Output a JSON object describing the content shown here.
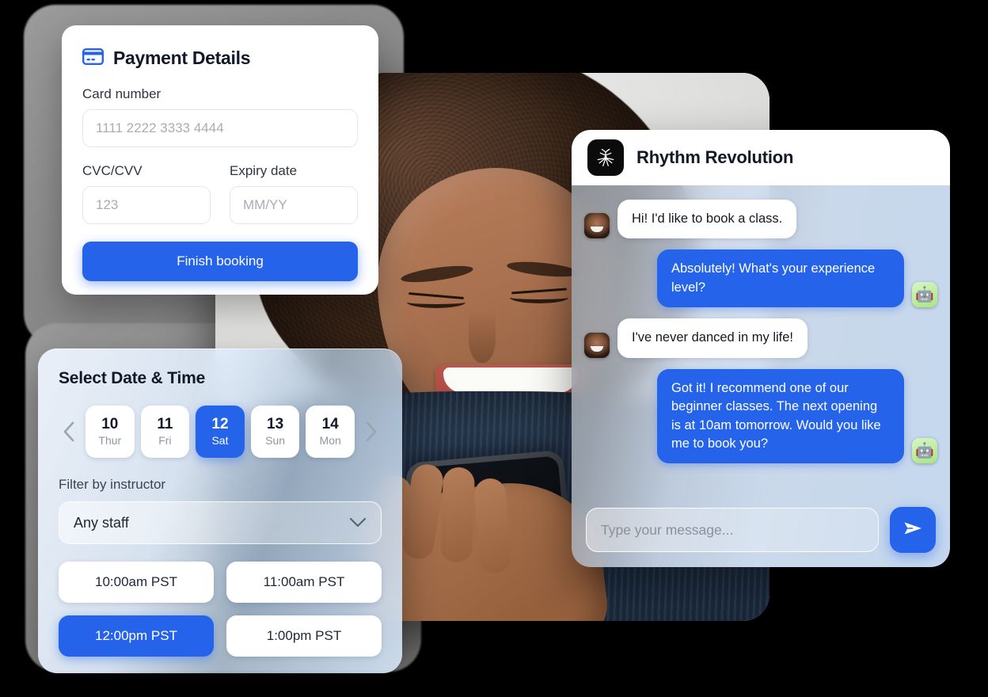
{
  "payment": {
    "icon": "credit-card-icon",
    "title": "Payment Details",
    "card_number_label": "Card number",
    "card_number_placeholder": "1111 2222 3333 4444",
    "cvc_label": "CVC/CVV",
    "cvc_placeholder": "123",
    "expiry_label": "Expiry date",
    "expiry_placeholder": "MM/YY",
    "submit_label": "Finish booking"
  },
  "datetime": {
    "title": "Select Date & Time",
    "prev_icon": "chevron-left-icon",
    "next_icon": "chevron-right-icon",
    "days": [
      {
        "num": "10",
        "dow": "Thur",
        "selected": false
      },
      {
        "num": "11",
        "dow": "Fri",
        "selected": false
      },
      {
        "num": "12",
        "dow": "Sat",
        "selected": true
      },
      {
        "num": "13",
        "dow": "Sun",
        "selected": false
      },
      {
        "num": "14",
        "dow": "Mon",
        "selected": false
      }
    ],
    "filter_label": "Filter by instructor",
    "filter_value": "Any staff",
    "filter_chevron_icon": "chevron-down-icon",
    "slots": [
      {
        "label": "10:00am PST",
        "selected": false
      },
      {
        "label": "11:00am PST",
        "selected": false
      },
      {
        "label": "12:00pm PST",
        "selected": true
      },
      {
        "label": "1:00pm PST",
        "selected": false
      }
    ]
  },
  "chat": {
    "logo_icon": "dancer-logo-icon",
    "title": "Rhythm Revolution",
    "messages": [
      {
        "from": "user",
        "text": "Hi! I'd like to book a class.",
        "avatar": "user-avatar"
      },
      {
        "from": "bot",
        "text": "Absolutely! What's your experience level?",
        "avatar": "robot-avatar"
      },
      {
        "from": "user",
        "text": "I've never danced in my life!",
        "avatar": "user-avatar"
      },
      {
        "from": "bot",
        "text": "Got it! I recommend one of our beginner classes. The next opening is at 10am tomorrow. Would you like me to book you?",
        "avatar": "robot-avatar"
      }
    ],
    "input_placeholder": "Type your message...",
    "send_icon": "send-paper-plane-icon",
    "bot_avatar_glyph": "🤖"
  },
  "theme": {
    "accent": "#2563EB",
    "text_dark": "#111827",
    "muted": "#8E97A3",
    "card_bg": "#FFFFFF",
    "page_bg": "#000000"
  }
}
